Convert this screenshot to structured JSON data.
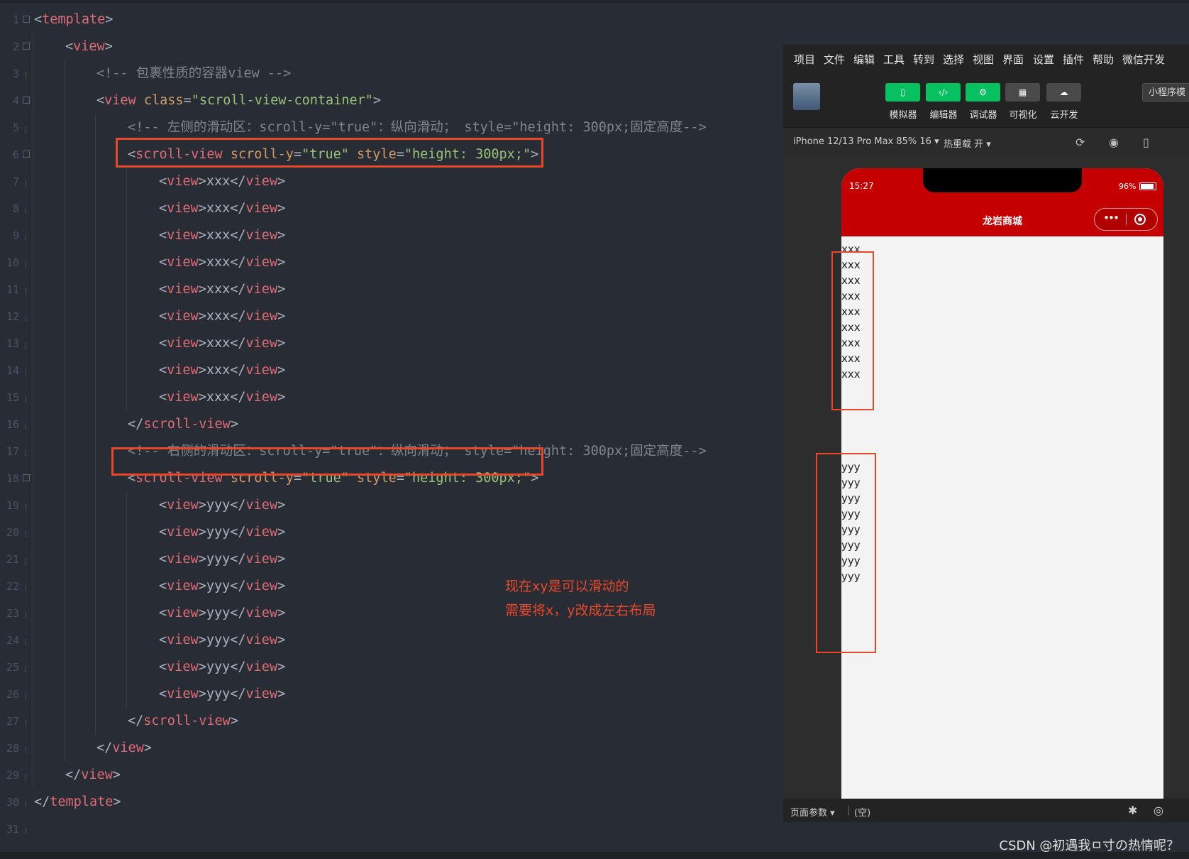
{
  "editor": {
    "lines": [
      {
        "num": "1",
        "fold": true,
        "indent": 0,
        "tokens": [
          [
            "br",
            "<"
          ],
          [
            "tag",
            "template"
          ],
          [
            "br",
            ">"
          ]
        ]
      },
      {
        "num": "2",
        "fold": true,
        "indent": 1,
        "tokens": [
          [
            "br",
            "<"
          ],
          [
            "tag",
            "view"
          ],
          [
            "br",
            ">"
          ]
        ]
      },
      {
        "num": "3",
        "fold": false,
        "indent": 2,
        "tokens": [
          [
            "cmt",
            "<!-- 包裹性质的容器view -->"
          ]
        ]
      },
      {
        "num": "4",
        "fold": true,
        "indent": 2,
        "tokens": [
          [
            "br",
            "<"
          ],
          [
            "tag",
            "view"
          ],
          [
            "br",
            " "
          ],
          [
            "attr",
            "class"
          ],
          [
            "br",
            "="
          ],
          [
            "str",
            "\"scroll-view-container\""
          ],
          [
            "br",
            ">"
          ]
        ]
      },
      {
        "num": "5",
        "fold": false,
        "indent": 3,
        "tokens": [
          [
            "cmt",
            "<!-- 左侧的滑动区：scroll-y=\"true\"：纵向滑动； style=\"height: 300px;固定高度-->"
          ]
        ]
      },
      {
        "num": "6",
        "fold": true,
        "indent": 3,
        "tokens": [
          [
            "br",
            "<"
          ],
          [
            "tag",
            "scroll-view"
          ],
          [
            "br",
            " "
          ],
          [
            "attr",
            "scroll-y"
          ],
          [
            "br",
            "="
          ],
          [
            "str",
            "\"true\""
          ],
          [
            "br",
            " "
          ],
          [
            "attr",
            "style"
          ],
          [
            "br",
            "="
          ],
          [
            "str",
            "\"height: 300px;\""
          ],
          [
            "br",
            ">"
          ]
        ]
      },
      {
        "num": "7",
        "fold": false,
        "indent": 4,
        "tokens": [
          [
            "br",
            "<"
          ],
          [
            "tag",
            "view"
          ],
          [
            "br",
            ">xxx</"
          ],
          [
            "tag",
            "view"
          ],
          [
            "br",
            ">"
          ]
        ]
      },
      {
        "num": "8",
        "fold": false,
        "indent": 4,
        "tokens": [
          [
            "br",
            "<"
          ],
          [
            "tag",
            "view"
          ],
          [
            "br",
            ">xxx</"
          ],
          [
            "tag",
            "view"
          ],
          [
            "br",
            ">"
          ]
        ]
      },
      {
        "num": "9",
        "fold": false,
        "indent": 4,
        "tokens": [
          [
            "br",
            "<"
          ],
          [
            "tag",
            "view"
          ],
          [
            "br",
            ">xxx</"
          ],
          [
            "tag",
            "view"
          ],
          [
            "br",
            ">"
          ]
        ]
      },
      {
        "num": "10",
        "fold": false,
        "indent": 4,
        "tokens": [
          [
            "br",
            "<"
          ],
          [
            "tag",
            "view"
          ],
          [
            "br",
            ">xxx</"
          ],
          [
            "tag",
            "view"
          ],
          [
            "br",
            ">"
          ]
        ]
      },
      {
        "num": "11",
        "fold": false,
        "indent": 4,
        "tokens": [
          [
            "br",
            "<"
          ],
          [
            "tag",
            "view"
          ],
          [
            "br",
            ">xxx</"
          ],
          [
            "tag",
            "view"
          ],
          [
            "br",
            ">"
          ]
        ]
      },
      {
        "num": "12",
        "fold": false,
        "indent": 4,
        "tokens": [
          [
            "br",
            "<"
          ],
          [
            "tag",
            "view"
          ],
          [
            "br",
            ">xxx</"
          ],
          [
            "tag",
            "view"
          ],
          [
            "br",
            ">"
          ]
        ]
      },
      {
        "num": "13",
        "fold": false,
        "indent": 4,
        "tokens": [
          [
            "br",
            "<"
          ],
          [
            "tag",
            "view"
          ],
          [
            "br",
            ">xxx</"
          ],
          [
            "tag",
            "view"
          ],
          [
            "br",
            ">"
          ]
        ]
      },
      {
        "num": "14",
        "fold": false,
        "indent": 4,
        "tokens": [
          [
            "br",
            "<"
          ],
          [
            "tag",
            "view"
          ],
          [
            "br",
            ">xxx</"
          ],
          [
            "tag",
            "view"
          ],
          [
            "br",
            ">"
          ]
        ]
      },
      {
        "num": "15",
        "fold": false,
        "indent": 4,
        "tokens": [
          [
            "br",
            "<"
          ],
          [
            "tag",
            "view"
          ],
          [
            "br",
            ">xxx</"
          ],
          [
            "tag",
            "view"
          ],
          [
            "br",
            ">"
          ]
        ]
      },
      {
        "num": "16",
        "fold": false,
        "indent": 3,
        "tokens": [
          [
            "br",
            "</"
          ],
          [
            "tag",
            "scroll-view"
          ],
          [
            "br",
            ">"
          ]
        ]
      },
      {
        "num": "17",
        "fold": false,
        "indent": 3,
        "tokens": [
          [
            "cmt",
            "<!-- 右侧的滑动区：scroll-y=\"true\"：纵向滑动； style=\"height: 300px;固定高度-->"
          ]
        ]
      },
      {
        "num": "18",
        "fold": true,
        "indent": 3,
        "tokens": [
          [
            "br",
            "<"
          ],
          [
            "tag",
            "scroll-view"
          ],
          [
            "br",
            " "
          ],
          [
            "attr",
            "scroll-y"
          ],
          [
            "br",
            "="
          ],
          [
            "str",
            "\"true\""
          ],
          [
            "br",
            " "
          ],
          [
            "attr",
            "style"
          ],
          [
            "br",
            "="
          ],
          [
            "str",
            "\"height: 300px;\""
          ],
          [
            "br",
            ">"
          ]
        ]
      },
      {
        "num": "19",
        "fold": false,
        "indent": 4,
        "tokens": [
          [
            "br",
            "<"
          ],
          [
            "tag",
            "view"
          ],
          [
            "br",
            ">yyy</"
          ],
          [
            "tag",
            "view"
          ],
          [
            "br",
            ">"
          ]
        ]
      },
      {
        "num": "20",
        "fold": false,
        "indent": 4,
        "tokens": [
          [
            "br",
            "<"
          ],
          [
            "tag",
            "view"
          ],
          [
            "br",
            ">yyy</"
          ],
          [
            "tag",
            "view"
          ],
          [
            "br",
            ">"
          ]
        ]
      },
      {
        "num": "21",
        "fold": false,
        "indent": 4,
        "tokens": [
          [
            "br",
            "<"
          ],
          [
            "tag",
            "view"
          ],
          [
            "br",
            ">yyy</"
          ],
          [
            "tag",
            "view"
          ],
          [
            "br",
            ">"
          ]
        ]
      },
      {
        "num": "22",
        "fold": false,
        "indent": 4,
        "tokens": [
          [
            "br",
            "<"
          ],
          [
            "tag",
            "view"
          ],
          [
            "br",
            ">yyy</"
          ],
          [
            "tag",
            "view"
          ],
          [
            "br",
            ">"
          ]
        ]
      },
      {
        "num": "23",
        "fold": false,
        "indent": 4,
        "tokens": [
          [
            "br",
            "<"
          ],
          [
            "tag",
            "view"
          ],
          [
            "br",
            ">yyy</"
          ],
          [
            "tag",
            "view"
          ],
          [
            "br",
            ">"
          ]
        ]
      },
      {
        "num": "24",
        "fold": false,
        "indent": 4,
        "tokens": [
          [
            "br",
            "<"
          ],
          [
            "tag",
            "view"
          ],
          [
            "br",
            ">yyy</"
          ],
          [
            "tag",
            "view"
          ],
          [
            "br",
            ">"
          ]
        ]
      },
      {
        "num": "25",
        "fold": false,
        "indent": 4,
        "tokens": [
          [
            "br",
            "<"
          ],
          [
            "tag",
            "view"
          ],
          [
            "br",
            ">yyy</"
          ],
          [
            "tag",
            "view"
          ],
          [
            "br",
            ">"
          ]
        ]
      },
      {
        "num": "26",
        "fold": false,
        "indent": 4,
        "tokens": [
          [
            "br",
            "<"
          ],
          [
            "tag",
            "view"
          ],
          [
            "br",
            ">yyy</"
          ],
          [
            "tag",
            "view"
          ],
          [
            "br",
            ">"
          ]
        ]
      },
      {
        "num": "27",
        "fold": false,
        "indent": 3,
        "tokens": [
          [
            "br",
            "</"
          ],
          [
            "tag",
            "scroll-view"
          ],
          [
            "br",
            ">"
          ]
        ]
      },
      {
        "num": "28",
        "fold": false,
        "indent": 2,
        "tokens": [
          [
            "br",
            "</"
          ],
          [
            "tag",
            "view"
          ],
          [
            "br",
            ">"
          ]
        ]
      },
      {
        "num": "29",
        "fold": false,
        "indent": 1,
        "tokens": [
          [
            "br",
            "</"
          ],
          [
            "tag",
            "view"
          ],
          [
            "br",
            ">"
          ]
        ]
      },
      {
        "num": "30",
        "fold": false,
        "indent": 0,
        "tokens": [
          [
            "br",
            "</"
          ],
          [
            "tag",
            "template"
          ],
          [
            "br",
            ">"
          ]
        ]
      },
      {
        "num": "31",
        "fold": false,
        "indent": 0,
        "tokens": []
      }
    ]
  },
  "annotation": {
    "line1": "现在xy是可以滑动的",
    "line2": "需要将x，y改成左右布局"
  },
  "devtools": {
    "menu": [
      "项目",
      "文件",
      "编辑",
      "工具",
      "转到",
      "选择",
      "视图",
      "界面",
      "设置",
      "插件",
      "帮助",
      "微信开发"
    ],
    "toolbar": [
      {
        "label": "模拟器",
        "icon": "phone-icon",
        "active": true
      },
      {
        "label": "编辑器",
        "icon": "code-icon",
        "active": true
      },
      {
        "label": "调试器",
        "icon": "debug-icon",
        "active": true
      },
      {
        "label": "可视化",
        "icon": "layout-icon",
        "active": false
      },
      {
        "label": "云开发",
        "icon": "cloud-icon",
        "active": false
      }
    ],
    "mini_button": "小程序模",
    "device": "iPhone 12/13 Pro Max 85% 16 ▾",
    "hot_reload": "热重载 开 ▾",
    "footer_left": "页面参数 ▾",
    "footer_mid": "(空)"
  },
  "phone": {
    "time": "15:27",
    "battery": "96%",
    "title": "龙岩商城",
    "x_items": [
      "xxx",
      "xxx",
      "xxx",
      "xxx",
      "xxx",
      "xxx",
      "xxx",
      "xxx",
      "xxx"
    ],
    "y_items": [
      "yyy",
      "yyy",
      "yyy",
      "yyy",
      "yyy",
      "yyy",
      "yyy",
      "yyy"
    ]
  },
  "watermark": "CSDN @初遇我ㅁ寸の热情呢？",
  "colors": {
    "accent_red": "#e8472a",
    "brand_red": "#c40000",
    "wechat_green": "#07c160"
  }
}
